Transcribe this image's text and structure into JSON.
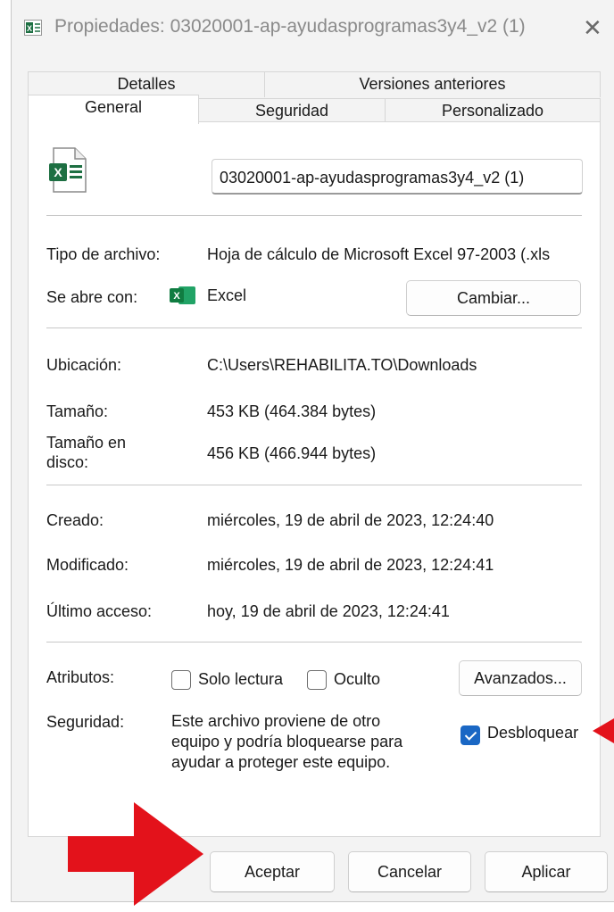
{
  "window": {
    "title": "Propiedades: 03020001-ap-ayudasprogramas3y4_v2 (1)",
    "close_glyph": "✕"
  },
  "tabs": {
    "row1": [
      "Detalles",
      "Versiones anteriores"
    ],
    "row2": [
      "General",
      "Seguridad",
      "Personalizado"
    ],
    "active": "General"
  },
  "general": {
    "file_name": "03020001-ap-ayudasprogramas3y4_v2 (1)",
    "file_type_label": "Tipo de archivo:",
    "file_type_value": "Hoja de cálculo de Microsoft Excel 97-2003 (.xls",
    "opens_with_label": "Se abre con:",
    "opens_with_app": "Excel",
    "change_button": "Cambiar...",
    "location_label": "Ubicación:",
    "location_value": "C:\\Users\\REHABILITA.TO\\Downloads",
    "size_label": "Tamaño:",
    "size_value": "453 KB (464.384 bytes)",
    "size_on_disk_label_1": "Tamaño en",
    "size_on_disk_label_2": "disco:",
    "size_on_disk_value": "456 KB (466.944 bytes)",
    "created_label": "Creado:",
    "created_value": "miércoles, 19 de abril de 2023, 12:24:40",
    "modified_label": "Modificado:",
    "modified_value": "miércoles, 19 de abril de 2023, 12:24:41",
    "accessed_label": "Último acceso:",
    "accessed_value": "hoy, 19 de abril de 2023, 12:24:41",
    "attributes_label": "Atributos:",
    "readonly_label": "Solo lectura",
    "readonly_checked": false,
    "hidden_label": "Oculto",
    "hidden_checked": false,
    "advanced_button": "Avanzados...",
    "security_label": "Seguridad:",
    "security_text_1": "Este archivo proviene de otro",
    "security_text_2": "equipo y podría bloquearse para",
    "security_text_3": "ayudar a proteger este equipo.",
    "unblock_label": "Desbloquear",
    "unblock_checked": true
  },
  "footer": {
    "ok": "Aceptar",
    "cancel": "Cancelar",
    "apply": "Aplicar"
  },
  "icons": {
    "title": "excel-file-small-icon",
    "file": "excel-spreadsheet-icon",
    "app": "excel-app-icon",
    "annotation_arrows": [
      "red-arrow-right",
      "red-arrow-left"
    ]
  },
  "colors": {
    "excel_green": "#1d6f42",
    "checkbox_blue": "#1a67c4",
    "annotation_red": "#e3121b"
  }
}
